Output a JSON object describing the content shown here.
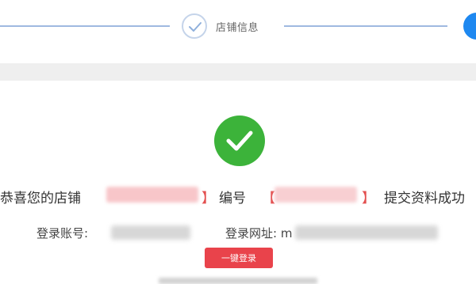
{
  "stepper": {
    "completed_step_label": "店铺信息",
    "check_icon": "check-icon"
  },
  "result": {
    "success_icon": "check-circle-icon",
    "message_prefix": "恭喜您的店铺",
    "bracket_open": "【",
    "bracket_close": "】",
    "number_label": "编号",
    "message_suffix": "提交资料成功",
    "account_label": "登录账号:",
    "login_url_label": "登录网址: m",
    "login_button_label": "一键登录"
  },
  "colors": {
    "success": "#3cb33a",
    "primary": "#1e88f0",
    "button": "#e9434b",
    "bracket": "#e34f4f"
  }
}
